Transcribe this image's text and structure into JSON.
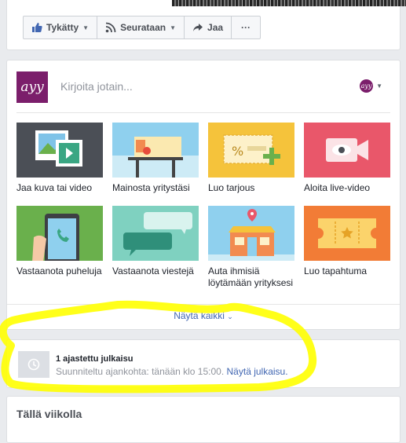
{
  "action_bar": {
    "like_label": "Tykätty",
    "follow_label": "Seurataan",
    "share_label": "Jaa",
    "more_label": "···"
  },
  "composer": {
    "avatar_text": "ayy",
    "placeholder": "Kirjoita jotain...",
    "mini_avatar_text": "ayy",
    "actions": [
      {
        "label": "Jaa kuva tai video",
        "icon": "photo-video-icon"
      },
      {
        "label": "Mainosta yritystäsi",
        "icon": "promote-billboard-icon"
      },
      {
        "label": "Luo tarjous",
        "icon": "offer-coupon-icon"
      },
      {
        "label": "Aloita live-video",
        "icon": "live-video-icon"
      },
      {
        "label": "Vastaanota puheluja",
        "icon": "phone-call-icon"
      },
      {
        "label": "Vastaanota viestejä",
        "icon": "messages-icon"
      },
      {
        "label": "Auta ihmisiä löytämään yrityksesi",
        "icon": "storefront-map-pin-icon"
      },
      {
        "label": "Luo tapahtuma",
        "icon": "event-ticket-icon"
      }
    ],
    "show_all_label": "Näytä kaikki"
  },
  "scheduled": {
    "title": "1 ajastettu julkaisu",
    "description": "Suunniteltu ajankohta: tänään klo 15:00.",
    "link_label": "Näytä julkaisu."
  },
  "this_week": {
    "title": "Tällä viikolla"
  },
  "colors": {
    "brand_purple": "#7b1e6b",
    "link_blue": "#4267b2",
    "highlight_yellow": "#ffff00"
  }
}
